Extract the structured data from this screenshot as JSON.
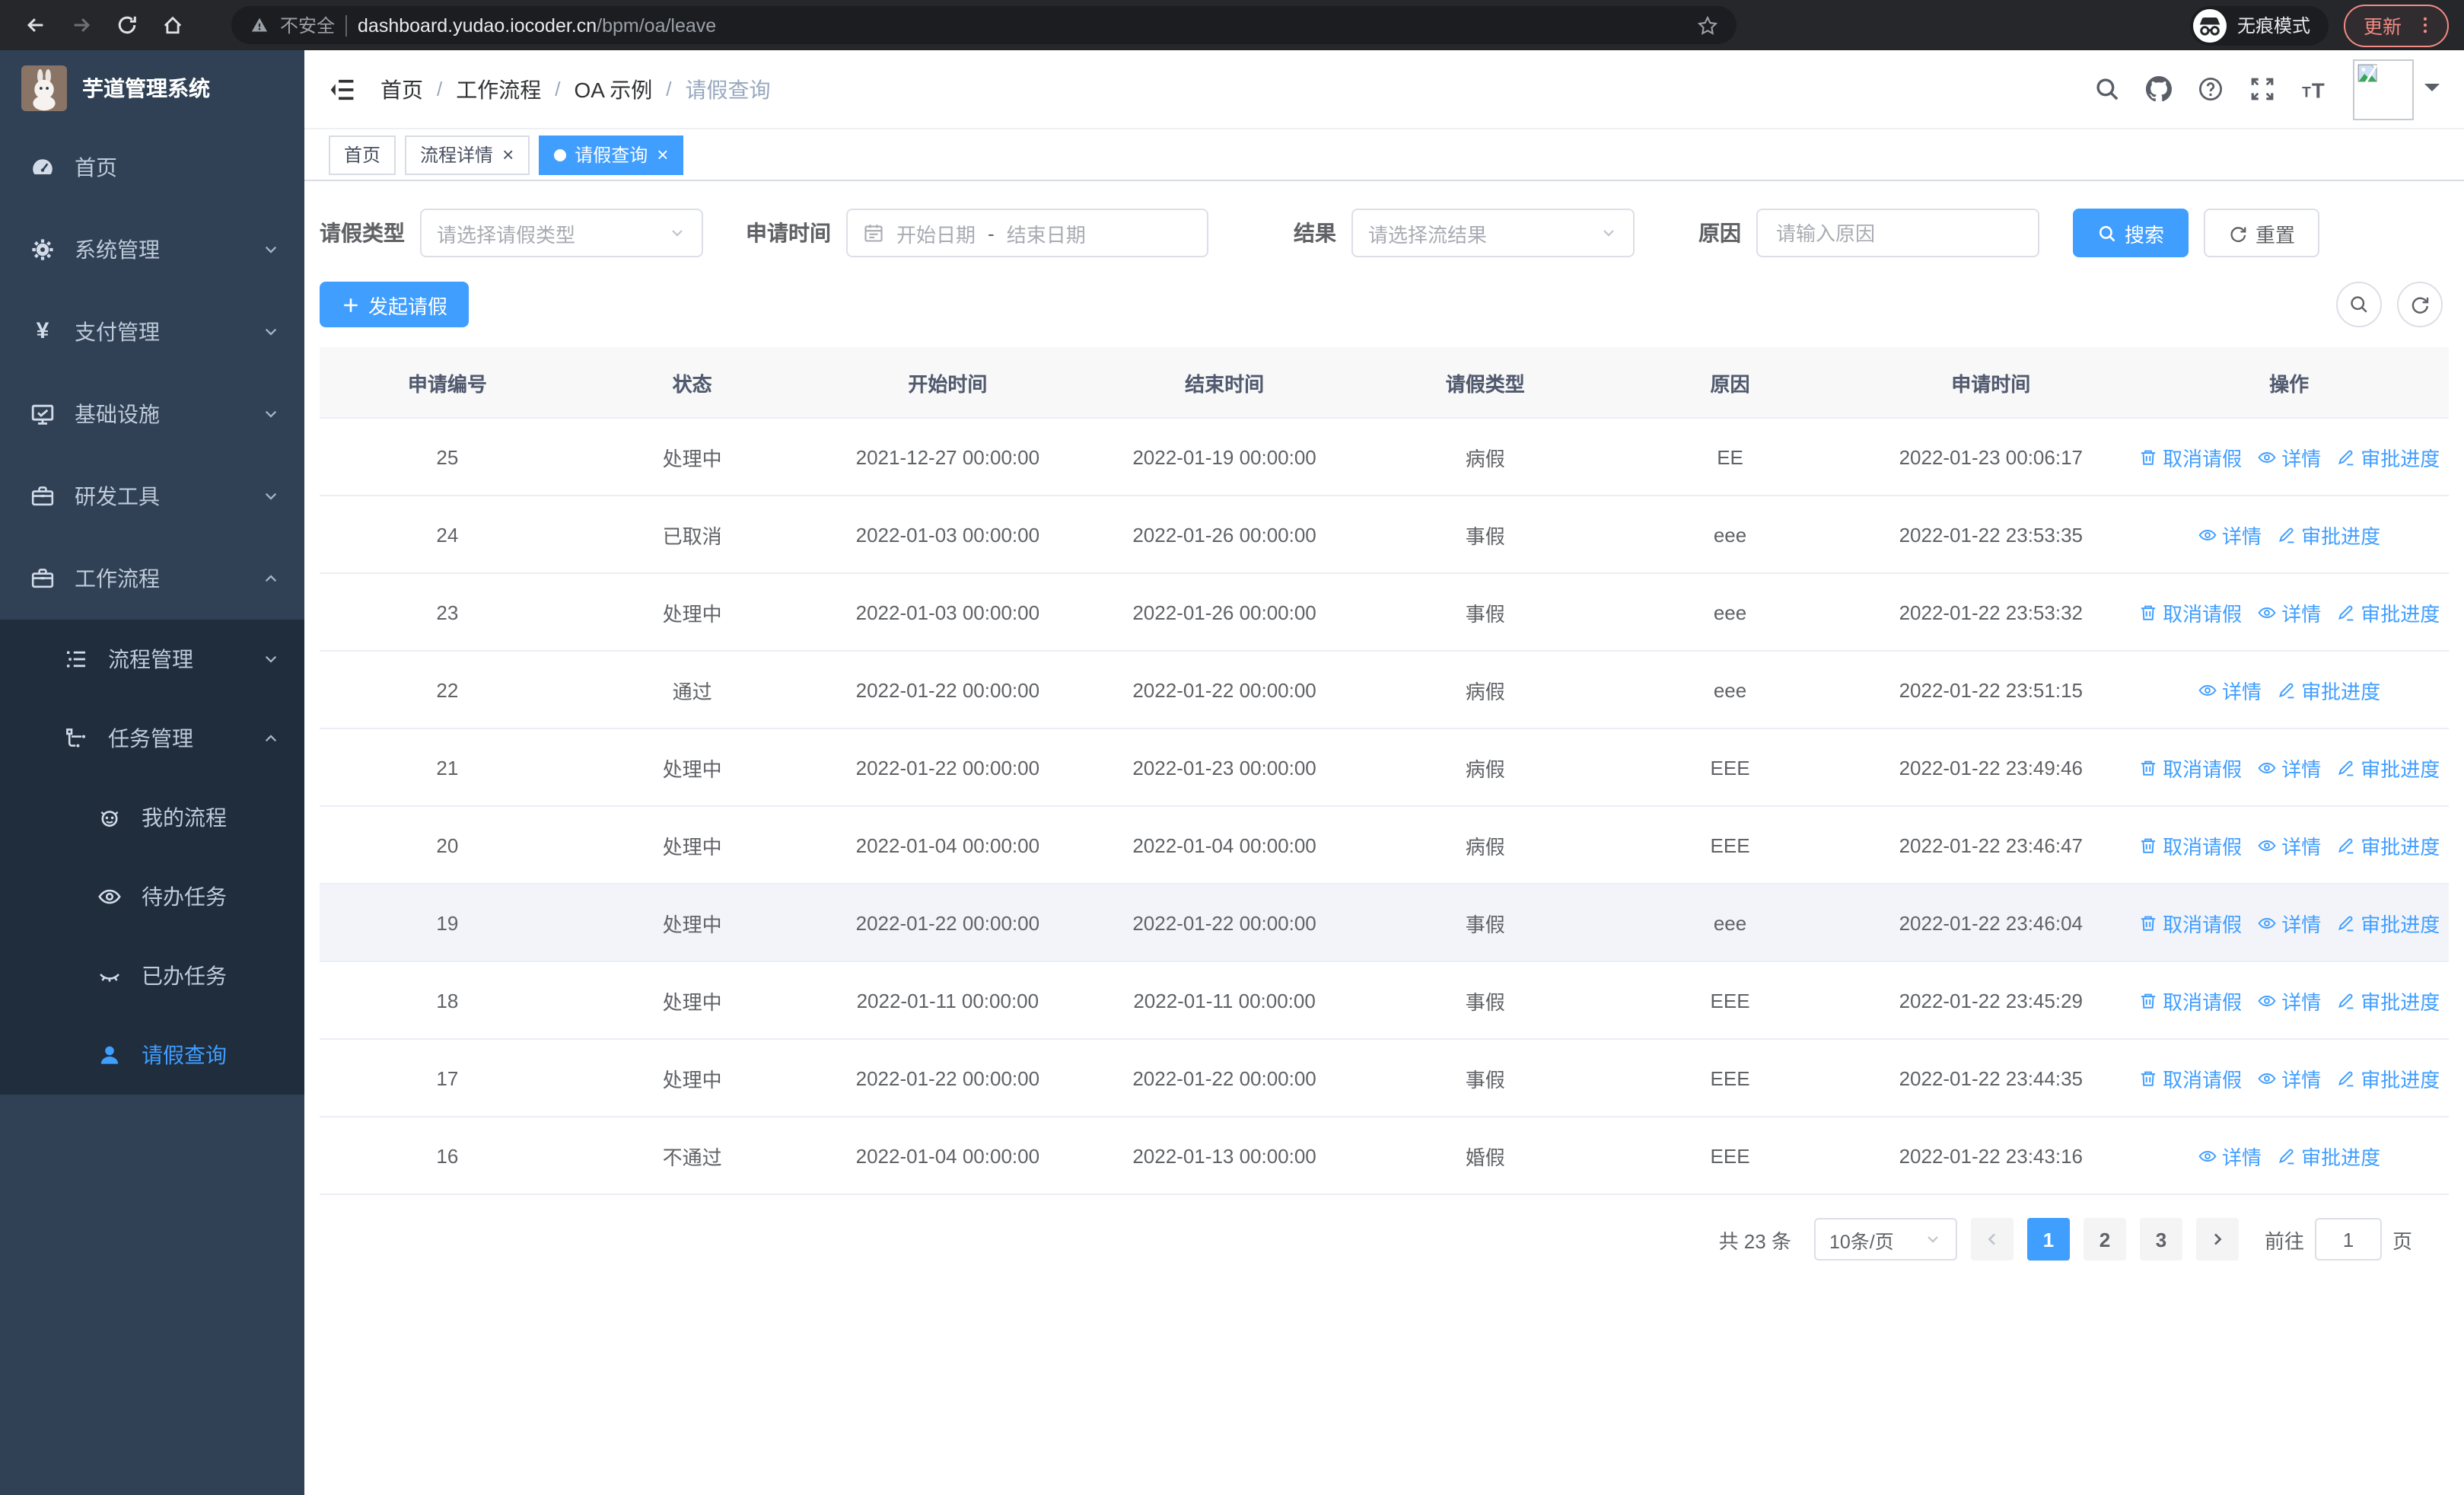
{
  "colors": {
    "primary": "#409eff",
    "sidebar_bg": "#304156",
    "submenu_bg": "#1f2d3d",
    "active_tab_bg": "#409eff"
  },
  "browser": {
    "security_label": "不安全",
    "url_host": "dashboard.yudao.iocoder.cn",
    "url_path": "/bpm/oa/leave",
    "incognito_label": "无痕模式",
    "update_label": "更新"
  },
  "sidebar": {
    "logo_title": "芋道管理系统",
    "menu": [
      {
        "key": "home",
        "label": "首页",
        "icon": "dashboard-icon"
      },
      {
        "key": "system",
        "label": "系统管理",
        "icon": "gear-icon",
        "chevron": "down"
      },
      {
        "key": "payment",
        "label": "支付管理",
        "icon": "yen-icon",
        "chevron": "down"
      },
      {
        "key": "infra",
        "label": "基础设施",
        "icon": "monitor-icon",
        "chevron": "down"
      },
      {
        "key": "devtools",
        "label": "研发工具",
        "icon": "toolbox-icon",
        "chevron": "down"
      },
      {
        "key": "workflow",
        "label": "工作流程",
        "icon": "toolbox-icon",
        "chevron": "up",
        "children": [
          {
            "key": "process-mgmt",
            "label": "流程管理",
            "icon": "process-list-icon",
            "chevron": "down"
          },
          {
            "key": "task-mgmt",
            "label": "任务管理",
            "icon": "task-icon",
            "chevron": "up",
            "children": [
              {
                "key": "my-process",
                "label": "我的流程",
                "icon": "robot-icon"
              },
              {
                "key": "todo-task",
                "label": "待办任务",
                "icon": "eye-icon"
              },
              {
                "key": "done-task",
                "label": "已办任务",
                "icon": "eye-closed-icon"
              },
              {
                "key": "leave-query",
                "label": "请假查询",
                "icon": "user-icon",
                "active": true
              }
            ]
          }
        ]
      }
    ]
  },
  "header": {
    "breadcrumb": [
      "首页",
      "工作流程",
      "OA 示例",
      "请假查询"
    ]
  },
  "tabs": [
    {
      "key": "home",
      "label": "首页",
      "closable": false,
      "active": false
    },
    {
      "key": "process-detail",
      "label": "流程详情",
      "closable": true,
      "active": false
    },
    {
      "key": "leave-query",
      "label": "请假查询",
      "closable": true,
      "active": true
    }
  ],
  "filters": {
    "leave_type_label": "请假类型",
    "leave_type_placeholder": "请选择请假类型",
    "apply_time_label": "申请时间",
    "start_date_placeholder": "开始日期",
    "range_separator": "-",
    "end_date_placeholder": "结束日期",
    "result_label": "结果",
    "result_placeholder": "请选择流结果",
    "reason_label": "原因",
    "reason_placeholder": "请输入原因",
    "search_label": "搜索",
    "reset_label": "重置"
  },
  "toolbar": {
    "create_label": "发起请假"
  },
  "table": {
    "columns": [
      "申请编号",
      "状态",
      "开始时间",
      "结束时间",
      "请假类型",
      "原因",
      "申请时间",
      "操作"
    ],
    "action_defs": {
      "cancel": {
        "label": "取消请假",
        "icon": "trash-icon"
      },
      "detail": {
        "label": "详情",
        "icon": "view-icon"
      },
      "progress": {
        "label": "审批进度",
        "icon": "pen-icon"
      }
    },
    "rows": [
      {
        "id": "25",
        "status": "处理中",
        "start_time": "2021-12-27 00:00:00",
        "end_time": "2022-01-19 00:00:00",
        "leave_type": "病假",
        "reason": "EE",
        "apply_time": "2022-01-23 00:06:17",
        "actions": [
          "cancel",
          "detail",
          "progress"
        ]
      },
      {
        "id": "24",
        "status": "已取消",
        "start_time": "2022-01-03 00:00:00",
        "end_time": "2022-01-26 00:00:00",
        "leave_type": "事假",
        "reason": "eee",
        "apply_time": "2022-01-22 23:53:35",
        "actions": [
          "detail",
          "progress"
        ]
      },
      {
        "id": "23",
        "status": "处理中",
        "start_time": "2022-01-03 00:00:00",
        "end_time": "2022-01-26 00:00:00",
        "leave_type": "事假",
        "reason": "eee",
        "apply_time": "2022-01-22 23:53:32",
        "actions": [
          "cancel",
          "detail",
          "progress"
        ]
      },
      {
        "id": "22",
        "status": "通过",
        "start_time": "2022-01-22 00:00:00",
        "end_time": "2022-01-22 00:00:00",
        "leave_type": "病假",
        "reason": "eee",
        "apply_time": "2022-01-22 23:51:15",
        "actions": [
          "detail",
          "progress"
        ]
      },
      {
        "id": "21",
        "status": "处理中",
        "start_time": "2022-01-22 00:00:00",
        "end_time": "2022-01-23 00:00:00",
        "leave_type": "病假",
        "reason": "EEE",
        "apply_time": "2022-01-22 23:49:46",
        "actions": [
          "cancel",
          "detail",
          "progress"
        ]
      },
      {
        "id": "20",
        "status": "处理中",
        "start_time": "2022-01-04 00:00:00",
        "end_time": "2022-01-04 00:00:00",
        "leave_type": "病假",
        "reason": "EEE",
        "apply_time": "2022-01-22 23:46:47",
        "actions": [
          "cancel",
          "detail",
          "progress"
        ]
      },
      {
        "id": "19",
        "status": "处理中",
        "start_time": "2022-01-22 00:00:00",
        "end_time": "2022-01-22 00:00:00",
        "leave_type": "事假",
        "reason": "eee",
        "apply_time": "2022-01-22 23:46:04",
        "actions": [
          "cancel",
          "detail",
          "progress"
        ],
        "highlighted": true
      },
      {
        "id": "18",
        "status": "处理中",
        "start_time": "2022-01-11 00:00:00",
        "end_time": "2022-01-11 00:00:00",
        "leave_type": "事假",
        "reason": "EEE",
        "apply_time": "2022-01-22 23:45:29",
        "actions": [
          "cancel",
          "detail",
          "progress"
        ]
      },
      {
        "id": "17",
        "status": "处理中",
        "start_time": "2022-01-22 00:00:00",
        "end_time": "2022-01-22 00:00:00",
        "leave_type": "事假",
        "reason": "EEE",
        "apply_time": "2022-01-22 23:44:35",
        "actions": [
          "cancel",
          "detail",
          "progress"
        ]
      },
      {
        "id": "16",
        "status": "不通过",
        "start_time": "2022-01-04 00:00:00",
        "end_time": "2022-01-13 00:00:00",
        "leave_type": "婚假",
        "reason": "EEE",
        "apply_time": "2022-01-22 23:43:16",
        "actions": [
          "detail",
          "progress"
        ]
      }
    ]
  },
  "pagination": {
    "total_label": "共 23 条",
    "page_size": "10条/页",
    "pages": [
      "1",
      "2",
      "3"
    ],
    "current_page": "1",
    "goto_label": "前往",
    "goto_value": "1",
    "goto_suffix": "页"
  }
}
